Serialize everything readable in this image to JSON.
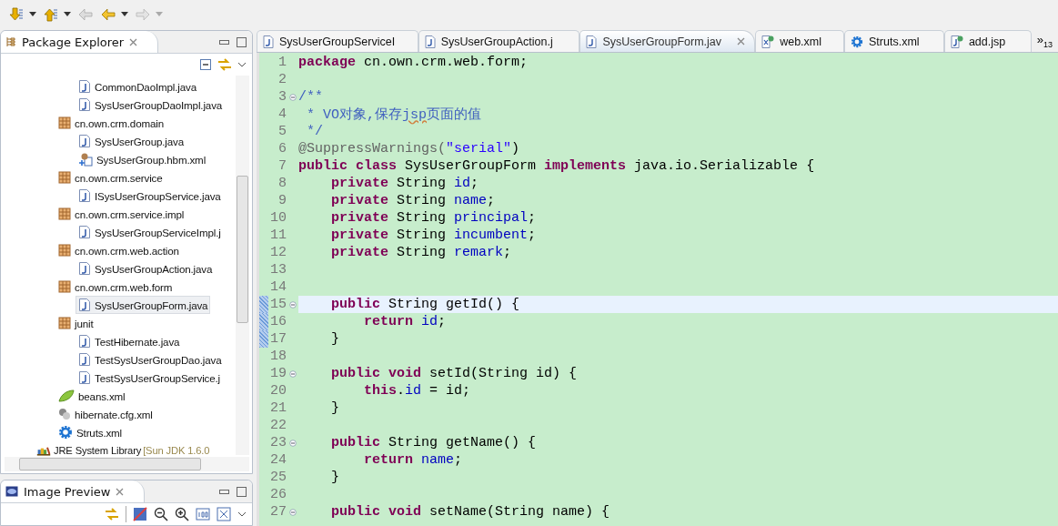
{
  "toolbar": [
    {
      "kind": "down",
      "disabled": false,
      "menu": true
    },
    {
      "kind": "up",
      "disabled": false,
      "menu": true
    },
    {
      "kind": "back-edit",
      "disabled": true,
      "menu": false
    },
    {
      "kind": "back",
      "disabled": false,
      "menu": true
    },
    {
      "kind": "forward",
      "disabled": true,
      "menu": true
    }
  ],
  "explorer": {
    "title": "Package Explorer",
    "tree": [
      {
        "children": [
          {
            "children": [
              {
                "kind": "java",
                "label": "CommonDaoImpl.java",
                "selected": false
              },
              {
                "kind": "java",
                "label": "SysUserGroupDaoImpl.java",
                "selected": false
              }
            ]
          },
          {
            "kind": "package",
            "label": "cn.own.crm.domain",
            "selected": false,
            "children": [
              {
                "kind": "java",
                "label": "SysUserGroup.java",
                "selected": false
              },
              {
                "kind": "hbm",
                "label": "SysUserGroup.hbm.xml",
                "selected": false
              }
            ]
          },
          {
            "kind": "package",
            "label": "cn.own.crm.service",
            "selected": false,
            "children": [
              {
                "kind": "java",
                "label": "ISysUserGroupService.java",
                "selected": false
              }
            ]
          },
          {
            "kind": "package",
            "label": "cn.own.crm.service.impl",
            "selected": false,
            "children": [
              {
                "kind": "java",
                "label": "SysUserGroupServiceImpl.j",
                "selected": false
              }
            ]
          },
          {
            "kind": "package",
            "label": "cn.own.crm.web.action",
            "selected": false,
            "children": [
              {
                "kind": "java",
                "label": "SysUserGroupAction.java",
                "selected": false
              }
            ]
          },
          {
            "kind": "package",
            "label": "cn.own.crm.web.form",
            "selected": false,
            "children": [
              {
                "kind": "java",
                "label": "SysUserGroupForm.java",
                "selected": true
              }
            ]
          },
          {
            "kind": "package",
            "label": "junit",
            "selected": false,
            "children": [
              {
                "kind": "java",
                "label": "TestHibernate.java",
                "selected": false
              },
              {
                "kind": "java",
                "label": "TestSysUserGroupDao.java",
                "selected": false
              },
              {
                "kind": "java",
                "label": "TestSysUserGroupService.j",
                "selected": false
              }
            ]
          },
          {
            "kind": "spring",
            "label": "beans.xml",
            "selected": false
          },
          {
            "kind": "hibernate",
            "label": "hibernate.cfg.xml",
            "selected": false
          },
          {
            "kind": "struts",
            "label": "Struts.xml",
            "selected": false
          }
        ]
      },
      {
        "kind": "library",
        "label": "JRE System Library",
        "detail": "[Sun JDK 1.6.0",
        "selected": false
      }
    ]
  },
  "preview": {
    "title": "Image Preview"
  },
  "editor": {
    "tabs": [
      {
        "kind": "java",
        "label": "SysUserGroupServiceI",
        "selected": false
      },
      {
        "kind": "java",
        "label": "SysUserGroupAction.j",
        "selected": false
      },
      {
        "kind": "java",
        "label": "SysUserGroupForm.jav",
        "selected": true
      },
      {
        "kind": "xml",
        "label": "web.xml",
        "selected": false
      },
      {
        "kind": "struts",
        "label": "Struts.xml",
        "selected": false
      },
      {
        "kind": "jsp",
        "label": "add.jsp",
        "selected": false
      }
    ],
    "overflow": {
      "symbol": "»",
      "count": "13"
    },
    "lines": [
      {
        "n": "1",
        "tokens": [
          {
            "t": "package",
            "kind": "kw"
          },
          {
            "t": " cn.own.crm.web.form;",
            "kind": "plain"
          }
        ]
      },
      {
        "n": "2"
      },
      {
        "n": "3",
        "fold": true,
        "tokens": [
          {
            "t": "/**",
            "kind": "comment"
          }
        ]
      },
      {
        "n": "4",
        "tokens": [
          {
            "t": " * VO对象,保存",
            "kind": "comment"
          },
          {
            "t": "jsp",
            "kind": "spell"
          },
          {
            "t": "页面的值",
            "kind": "comment"
          }
        ]
      },
      {
        "n": "5",
        "tokens": [
          {
            "t": " */",
            "kind": "comment"
          }
        ]
      },
      {
        "n": "6",
        "tokens": [
          {
            "t": "@SuppressWarnings(",
            "kind": "annot"
          },
          {
            "t": "\"serial\"",
            "kind": "str"
          },
          {
            "t": ")",
            "kind": "plain"
          }
        ]
      },
      {
        "n": "7",
        "tokens": [
          {
            "t": "public",
            "kind": "kw"
          },
          {
            "t": " class",
            "kind": "kw"
          },
          {
            "t": " SysUserGroupForm",
            "kind": "plain"
          },
          {
            "t": " implements",
            "kind": "kw"
          },
          {
            "t": " java.io.Serializable {",
            "kind": "plain"
          }
        ]
      },
      {
        "n": "8",
        "tokens": [
          {
            "t": "    private",
            "kind": "kw"
          },
          {
            "t": " String",
            "kind": "plain"
          },
          {
            "t": " id",
            "kind": "field"
          },
          {
            "t": ";",
            "kind": "plain"
          }
        ]
      },
      {
        "n": "9",
        "tokens": [
          {
            "t": "    private",
            "kind": "kw"
          },
          {
            "t": " String",
            "kind": "plain"
          },
          {
            "t": " name",
            "kind": "field"
          },
          {
            "t": ";",
            "kind": "plain"
          }
        ]
      },
      {
        "n": "10",
        "tokens": [
          {
            "t": "    private",
            "kind": "kw"
          },
          {
            "t": " String",
            "kind": "plain"
          },
          {
            "t": " principal",
            "kind": "field"
          },
          {
            "t": ";",
            "kind": "plain"
          }
        ]
      },
      {
        "n": "11",
        "tokens": [
          {
            "t": "    private",
            "kind": "kw"
          },
          {
            "t": " String",
            "kind": "plain"
          },
          {
            "t": " incumbent",
            "kind": "field"
          },
          {
            "t": ";",
            "kind": "plain"
          }
        ]
      },
      {
        "n": "12",
        "tokens": [
          {
            "t": "    private",
            "kind": "kw"
          },
          {
            "t": " String",
            "kind": "plain"
          },
          {
            "t": " remark",
            "kind": "field"
          },
          {
            "t": ";",
            "kind": "plain"
          }
        ]
      },
      {
        "n": "13"
      },
      {
        "n": "14"
      },
      {
        "n": "15",
        "fold": true,
        "current": true,
        "range": true,
        "tokens": [
          {
            "t": "    public",
            "kind": "kw"
          },
          {
            "t": " String getId() {",
            "kind": "plain"
          }
        ]
      },
      {
        "n": "16",
        "range": true,
        "tokens": [
          {
            "t": "        return",
            "kind": "kw"
          },
          {
            "t": " id",
            "kind": "field"
          },
          {
            "t": ";",
            "kind": "plain"
          }
        ]
      },
      {
        "n": "17",
        "range": true,
        "tokens": [
          {
            "t": "    }",
            "kind": "plain"
          }
        ]
      },
      {
        "n": "18"
      },
      {
        "n": "19",
        "fold": true,
        "tokens": [
          {
            "t": "    public",
            "kind": "kw"
          },
          {
            "t": " void",
            "kind": "kw"
          },
          {
            "t": " setId(String id) {",
            "kind": "plain"
          }
        ]
      },
      {
        "n": "20",
        "tokens": [
          {
            "t": "        this",
            "kind": "kw"
          },
          {
            "t": ".",
            "kind": "plain"
          },
          {
            "t": "id",
            "kind": "field"
          },
          {
            "t": " = id;",
            "kind": "plain"
          }
        ]
      },
      {
        "n": "21",
        "tokens": [
          {
            "t": "    }",
            "kind": "plain"
          }
        ]
      },
      {
        "n": "22"
      },
      {
        "n": "23",
        "fold": true,
        "tokens": [
          {
            "t": "    public",
            "kind": "kw"
          },
          {
            "t": " String getName() {",
            "kind": "plain"
          }
        ]
      },
      {
        "n": "24",
        "tokens": [
          {
            "t": "        return",
            "kind": "kw"
          },
          {
            "t": " name",
            "kind": "field"
          },
          {
            "t": ";",
            "kind": "plain"
          }
        ]
      },
      {
        "n": "25",
        "tokens": [
          {
            "t": "    }",
            "kind": "plain"
          }
        ]
      },
      {
        "n": "26"
      },
      {
        "n": "27",
        "fold": true,
        "tokens": [
          {
            "t": "    public",
            "kind": "kw"
          },
          {
            "t": " void",
            "kind": "kw"
          },
          {
            "t": " setName(String name) {",
            "kind": "plain"
          }
        ]
      }
    ]
  }
}
